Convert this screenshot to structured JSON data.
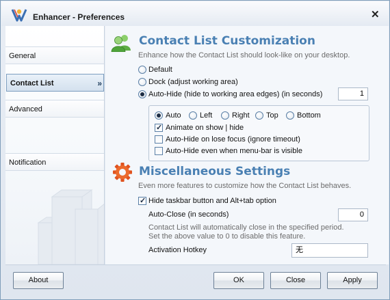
{
  "window": {
    "title": "Enhancer - Preferences",
    "close_glyph": "✕"
  },
  "sidebar": {
    "items": [
      {
        "label": "General"
      },
      {
        "label": "Contact List",
        "active": true,
        "arrow": "»"
      },
      {
        "label": "Advanced"
      },
      {
        "label": "Notification"
      }
    ]
  },
  "contact_list": {
    "title": "Contact List Customization",
    "description": "Enhance how the Contact List should look-like on your desktop.",
    "icon": "users-icon",
    "mode_options": [
      {
        "label": "Default",
        "checked": false
      },
      {
        "label": "Dock (adjust working area)",
        "checked": false
      },
      {
        "label": "Auto-Hide (hide to working area edges) (in seconds)",
        "checked": true
      }
    ],
    "autohide_seconds": "1",
    "edge_options": [
      {
        "label": "Auto",
        "checked": true
      },
      {
        "label": "Left",
        "checked": false
      },
      {
        "label": "Right",
        "checked": false
      },
      {
        "label": "Top",
        "checked": false
      },
      {
        "label": "Bottom",
        "checked": false
      }
    ],
    "autohide_checks": [
      {
        "label": "Animate on show | hide",
        "checked": true
      },
      {
        "label": "Auto-Hide on lose focus (ignore timeout)",
        "checked": false
      },
      {
        "label": "Auto-Hide even when menu-bar is visible",
        "checked": false
      }
    ]
  },
  "misc": {
    "title": "Miscellaneous Settings",
    "description": "Even more features to customize how the Contact List behaves.",
    "icon": "gear-icon",
    "hide_taskbar": {
      "label": "Hide taskbar button and Alt+tab option",
      "checked": true
    },
    "auto_close_label": "Auto-Close (in seconds)",
    "auto_close_value": "0",
    "auto_close_note_1": "Contact List will automatically close in the specified period.",
    "auto_close_note_2": "Set the above value to 0 to disable this feature.",
    "hotkey_label": "Activation Hotkey",
    "hotkey_value": "无"
  },
  "buttons": {
    "about": "About",
    "ok": "OK",
    "close": "Close",
    "apply": "Apply"
  },
  "colors": {
    "accent": "#4a80b3",
    "border": "#7f9db9",
    "gear": "#e0531f",
    "users": "#4fa43a"
  }
}
